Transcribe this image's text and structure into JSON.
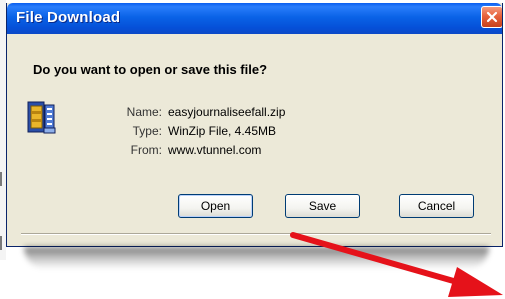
{
  "dialog": {
    "title": "File Download",
    "question": "Do you want to open or save this file?",
    "file": {
      "name_label": "Name:",
      "name": "easyjournaliseefall.zip",
      "type_label": "Type:",
      "type": "WinZip File, 4.45MB",
      "from_label": "From:",
      "from": "www.vtunnel.com"
    },
    "buttons": {
      "open": "Open",
      "save": "Save",
      "cancel": "Cancel"
    }
  },
  "icons": {
    "title_close": "close-icon",
    "file": "winzip-file-icon",
    "annotation": "red-arrow-icon"
  },
  "colors": {
    "titlebar": "#0a5ef0",
    "dialog_background": "#ece9d8",
    "close_button": "#e7623c",
    "button_border": "#003c74",
    "arrow": "#e5121a"
  }
}
